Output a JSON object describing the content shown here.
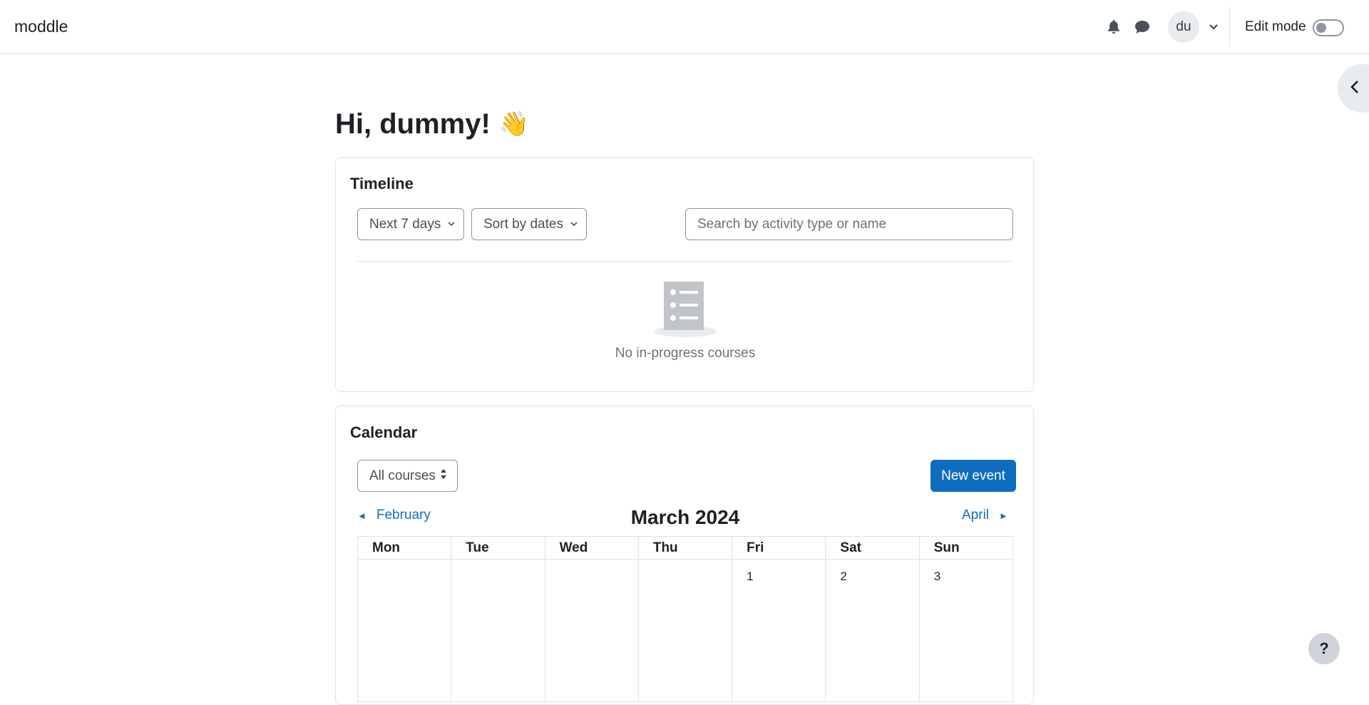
{
  "navbar": {
    "brand": "moddle",
    "user_initials": "du",
    "edit_mode_label": "Edit mode"
  },
  "icons": {
    "notifications": "bell-icon",
    "messages": "chat-icon",
    "user_menu": "chevron-down-icon",
    "drawer": "chevron-left-icon",
    "help": "help-icon"
  },
  "main": {
    "greeting": "Hi, dummy!",
    "greeting_emoji": "👋"
  },
  "timeline": {
    "title": "Timeline",
    "filter_label": "Next 7 days",
    "sort_label": "Sort by dates",
    "search_placeholder": "Search by activity type or name",
    "empty_text": "No in-progress courses"
  },
  "calendar": {
    "title": "Calendar",
    "course_filter": "All courses",
    "new_event_label": "New event",
    "prev_month": "February",
    "next_month": "April",
    "prev_arrow": "◄",
    "next_arrow": "►",
    "month_title": "March 2024",
    "weekdays": [
      "Mon",
      "Tue",
      "Wed",
      "Thu",
      "Fri",
      "Sat",
      "Sun"
    ],
    "week1": [
      "",
      "",
      "",
      "",
      "1",
      "2",
      "3"
    ]
  },
  "help": {
    "label": "?"
  },
  "colors": {
    "primary": "#0f6cbf",
    "border": "#dee2e6",
    "muted_text": "#6a737b"
  }
}
